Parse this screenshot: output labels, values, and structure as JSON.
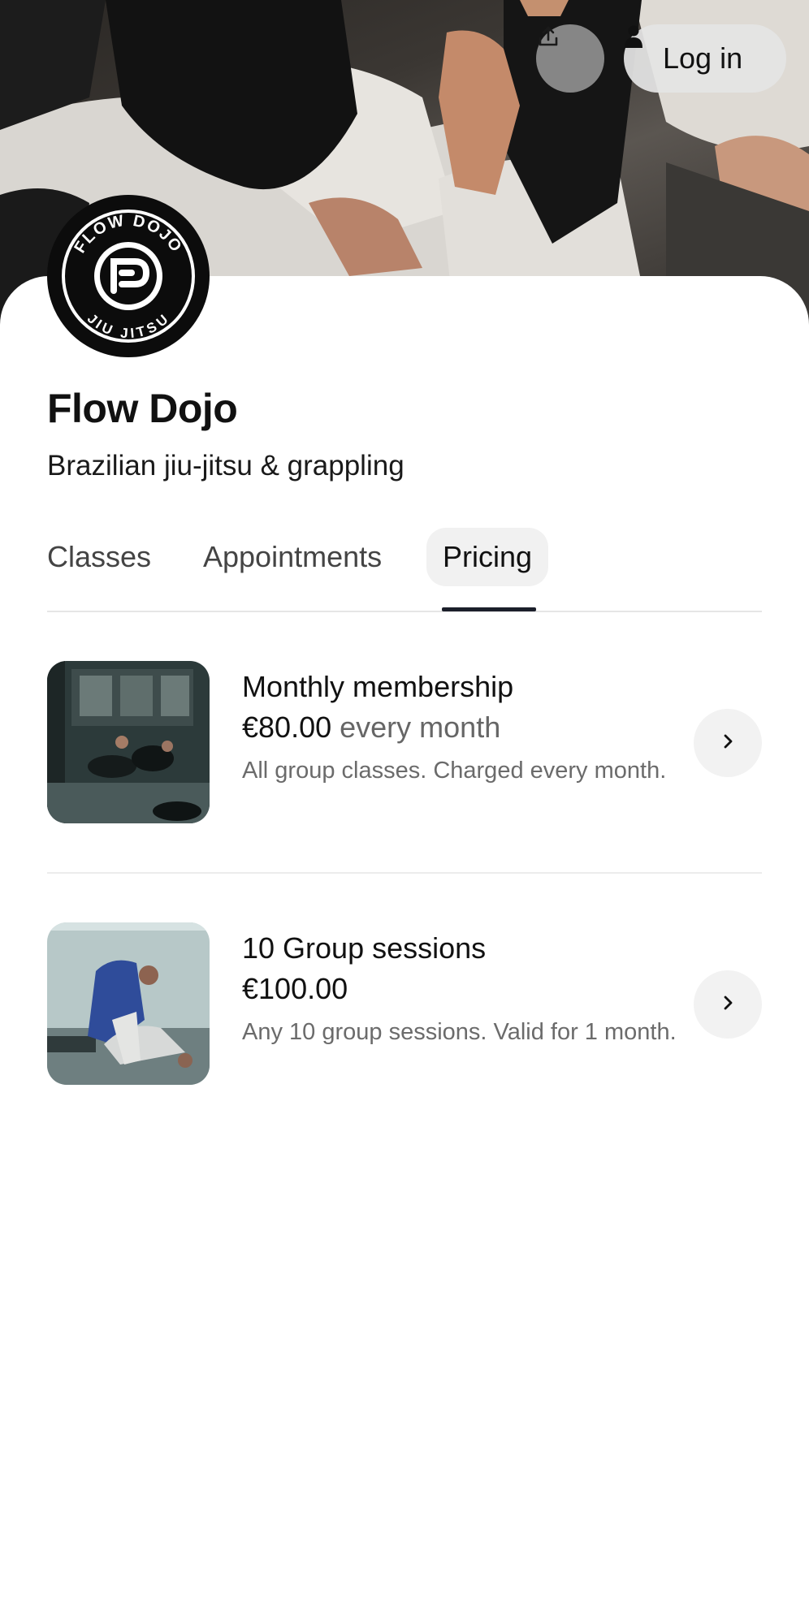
{
  "header": {
    "login_label": "Log in",
    "share_icon": "share-icon",
    "user_icon": "user-icon"
  },
  "business": {
    "name": "Flow Dojo",
    "tagline": "Brazilian jiu-jitsu & grappling",
    "logo_top_text": "FLOW DOJO",
    "logo_bottom_text": "JIU JITSU"
  },
  "tabs": [
    {
      "label": "Classes",
      "active": false
    },
    {
      "label": "Appointments",
      "active": false
    },
    {
      "label": "Pricing",
      "active": true
    }
  ],
  "pricing": [
    {
      "title": "Monthly membership",
      "price": "€80.00",
      "period": "every month",
      "description": "All group classes. Charged every month."
    },
    {
      "title": "10 Group sessions",
      "price": "€100.00",
      "period": "",
      "description": "Any 10 group sessions. Valid for 1 month."
    }
  ],
  "colors": {
    "accent": "#1b1f2a",
    "tab_active_bg": "#f1f1f1",
    "muted_text": "#6b6b6b"
  }
}
